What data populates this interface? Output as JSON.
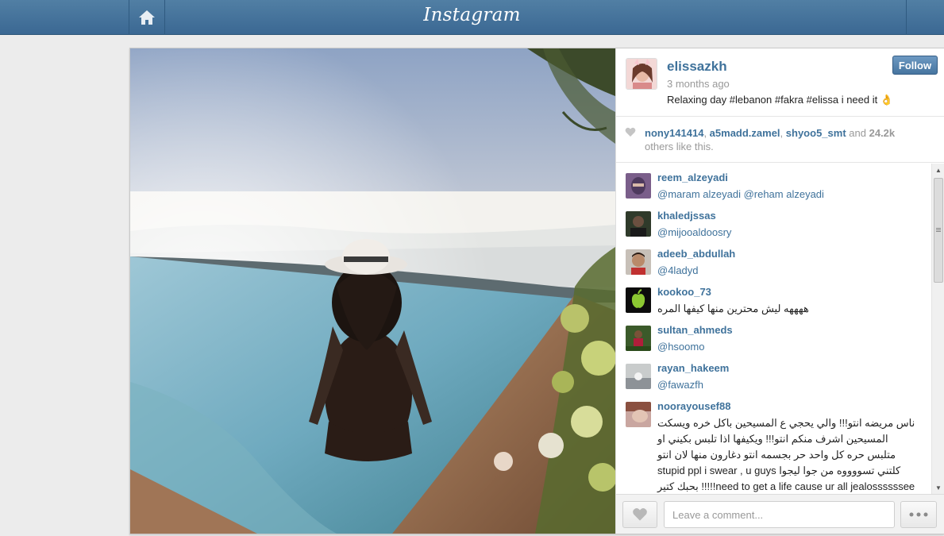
{
  "header": {
    "logo": "Instagram",
    "home_icon": "home-icon"
  },
  "post": {
    "username": "elissazkh",
    "time_ago": "3 months ago",
    "caption": "Relaxing day #lebanon #fakra #elissa i need it 👌",
    "follow_label": "Follow"
  },
  "likes": {
    "users": [
      "nony141414",
      "a5madd.zamel",
      "shyoo5_smt"
    ],
    "and": "and",
    "count": "24.2k",
    "suffix": "others like this."
  },
  "comments": [
    {
      "user": "reem_alzeyadi",
      "text": "@maram  alzeyadi @reham  alzeyadi",
      "mention": true
    },
    {
      "user": "khaledjssas",
      "text": "@mijooaldoosry",
      "mention": true
    },
    {
      "user": "adeeb_abdullah",
      "text": "@4ladyd",
      "mention": true
    },
    {
      "user": "kookoo_73",
      "text": "ههههه ليش محترين منها كيفها المره",
      "mention": false,
      "rtl": true
    },
    {
      "user": "sultan_ahmeds",
      "text": "@hsoomo",
      "mention": true
    },
    {
      "user": "rayan_hakeem",
      "text": "@fawazfh",
      "mention": true
    },
    {
      "user": "noorayousef88",
      "text": "ناس مريضه انتو!!! والي يحجي ع المسيحين باكل خره ويسكت المسيحين اشرف منكم انتو!!! ويكيفها اذا تلبس بكيني او متلبس حره كل واحد حر بجسمه انتو دغارون منها لان انتو كلتني تسووووه من جوا ليجوا stupid ppl i swear , u guys need to get a life cause ur all jealossssssee!!!!! بحبك كتير اليسا واني افتخر لان الله خلقني مسيحيه",
      "mention": false,
      "rtl": true
    }
  ],
  "compose": {
    "placeholder": "Leave a comment..."
  },
  "colors": {
    "brand": "#3f729b",
    "topbar": "#517fa4"
  }
}
